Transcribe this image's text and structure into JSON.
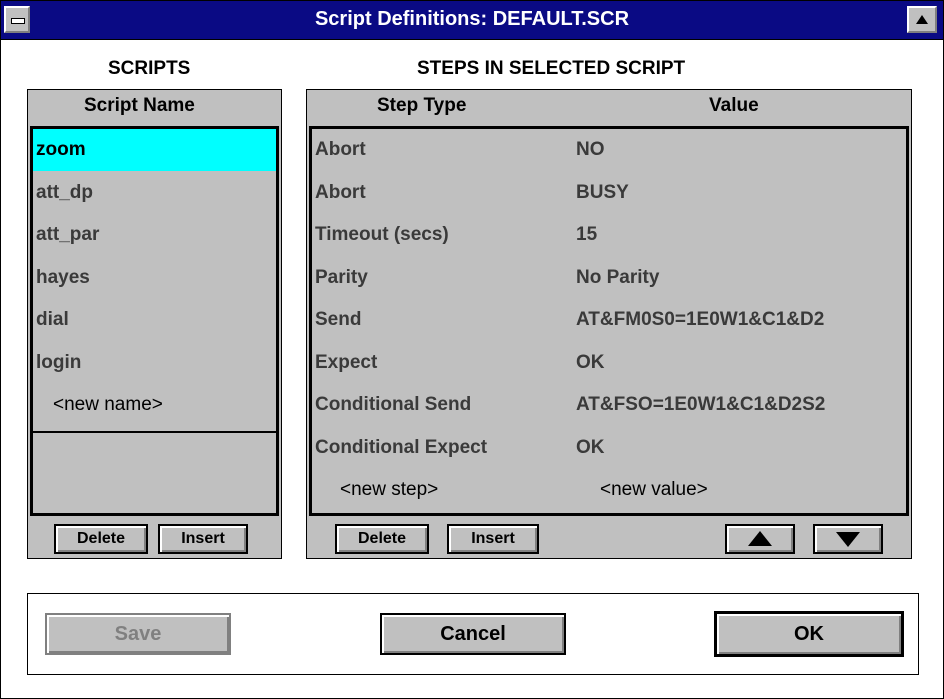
{
  "window": {
    "title": "Script Definitions: DEFAULT.SCR"
  },
  "scripts": {
    "heading": "SCRIPTS",
    "column": "Script Name",
    "items": [
      "zoom",
      "att_dp",
      "att_par",
      "hayes",
      "dial",
      "login"
    ],
    "selected": "zoom",
    "new_item": "<new name>",
    "delete_label": "Delete",
    "insert_label": "Insert"
  },
  "steps": {
    "heading": "STEPS IN SELECTED SCRIPT",
    "col_type": "Step Type",
    "col_value": "Value",
    "rows": [
      {
        "type": "Abort",
        "value": "NO"
      },
      {
        "type": "Abort",
        "value": "BUSY"
      },
      {
        "type": "Timeout (secs)",
        "value": "15"
      },
      {
        "type": "Parity",
        "value": "No Parity"
      },
      {
        "type": "Send",
        "value": "AT&FM0S0=1E0W1&C1&D2"
      },
      {
        "type": "Expect",
        "value": "OK"
      },
      {
        "type": "Conditional Send",
        "value": "AT&FSO=1E0W1&C1&D2S2"
      },
      {
        "type": "Conditional Expect",
        "value": "OK"
      }
    ],
    "new_step": "<new step>",
    "new_value": "<new value>",
    "delete_label": "Delete",
    "insert_label": "Insert"
  },
  "footer": {
    "save_label": "Save",
    "cancel_label": "Cancel",
    "ok_label": "OK"
  },
  "colors": {
    "titlebar": "#0a0a84",
    "selection": "#00ffff",
    "panel": "#c0c0c0"
  }
}
